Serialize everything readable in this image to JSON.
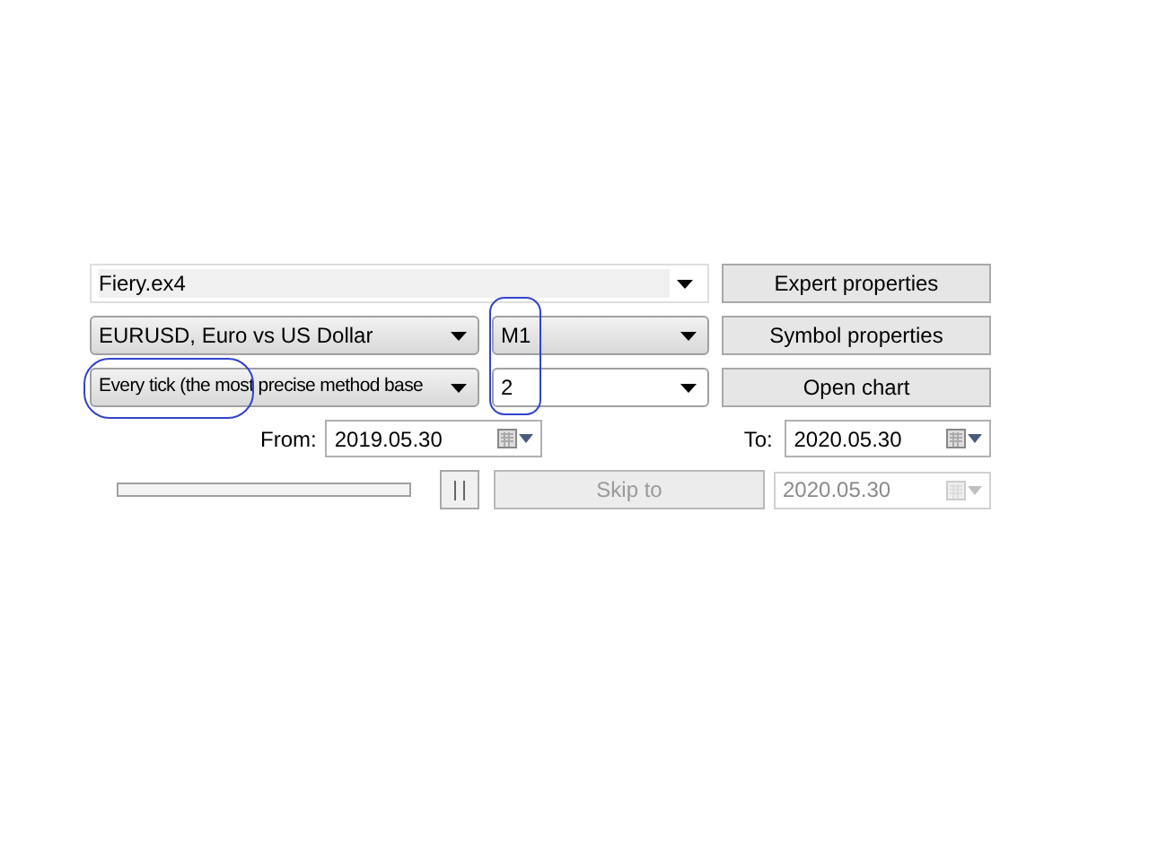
{
  "expert": {
    "value": "Fiery.ex4"
  },
  "symbol": {
    "value": "EURUSD, Euro vs US Dollar"
  },
  "period": {
    "value": "M1"
  },
  "model": {
    "value": "Every tick (the most precise method base"
  },
  "spread": {
    "value": "2"
  },
  "buttons": [
    {
      "label": "Expert properties"
    },
    {
      "label": "Symbol properties"
    },
    {
      "label": "Open chart"
    }
  ],
  "from": {
    "label": "From:",
    "value": "2019.05.30",
    "disabled": false
  },
  "to": {
    "label": "To:",
    "value": "2020.05.30",
    "disabled": false
  },
  "progress": {
    "level": 0
  },
  "skip": {
    "label": "Skip to",
    "disabled": true
  },
  "skip_date": {
    "value": "2020.05.30",
    "disabled": true
  }
}
